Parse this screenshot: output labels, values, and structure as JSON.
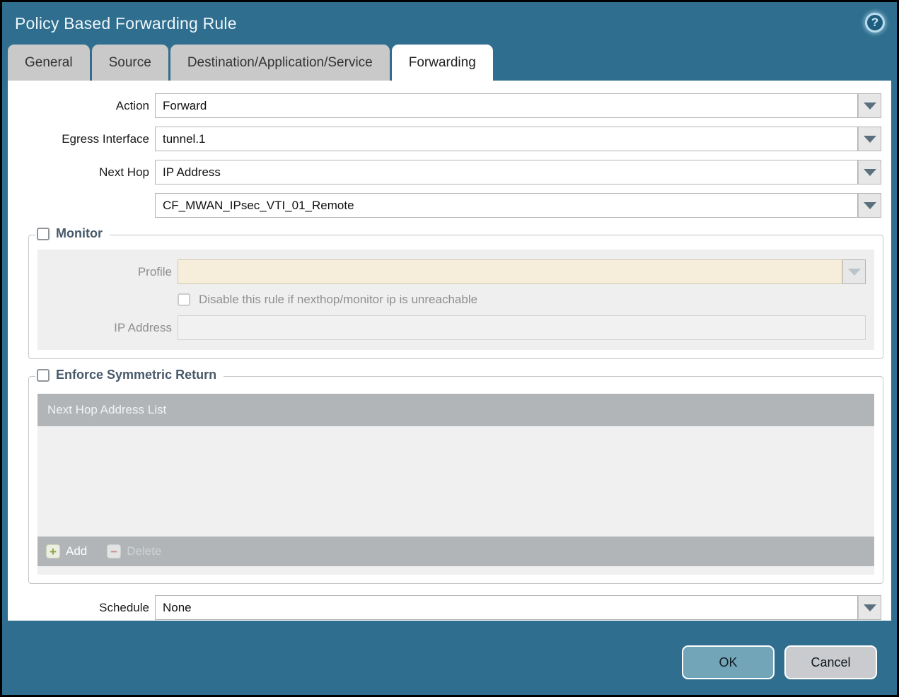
{
  "window": {
    "title": "Policy Based Forwarding Rule",
    "help_glyph": "?"
  },
  "tabs": [
    {
      "label": "General",
      "active": false
    },
    {
      "label": "Source",
      "active": false
    },
    {
      "label": "Destination/Application/Service",
      "active": false
    },
    {
      "label": "Forwarding",
      "active": true
    }
  ],
  "form": {
    "action": {
      "label": "Action",
      "value": "Forward"
    },
    "egress_interface": {
      "label": "Egress Interface",
      "value": "tunnel.1"
    },
    "next_hop": {
      "label": "Next Hop",
      "value": "IP Address"
    },
    "next_hop_address": {
      "value": "CF_MWAN_IPsec_VTI_01_Remote"
    },
    "schedule": {
      "label": "Schedule",
      "value": "None"
    }
  },
  "monitor": {
    "legend": "Monitor",
    "checked": false,
    "profile": {
      "label": "Profile",
      "value": ""
    },
    "disable_rule_label": "Disable this rule if nexthop/monitor ip is unreachable",
    "disable_rule_checked": false,
    "ip_address": {
      "label": "IP Address",
      "value": ""
    }
  },
  "symmetric_return": {
    "legend": "Enforce Symmetric Return",
    "checked": false,
    "table_header": "Next Hop Address List",
    "rows": [],
    "add_label": "Add",
    "delete_label": "Delete",
    "delete_enabled": false
  },
  "footer": {
    "ok_label": "OK",
    "cancel_label": "Cancel"
  },
  "colors": {
    "titlebar": "#2f6e8e",
    "tab_inactive": "#c9c9c9",
    "tab_active": "#ffffff",
    "table_header": "#b2b5b8",
    "panel_gray": "#efefef",
    "profile_disabled_bg": "#f6eedb",
    "ok_button": "#73a5b9",
    "cancel_button": "#c9cbce",
    "add_plus": "#8aa23c",
    "delete_minus": "#c98c8c",
    "legend_text": "#47596a"
  }
}
